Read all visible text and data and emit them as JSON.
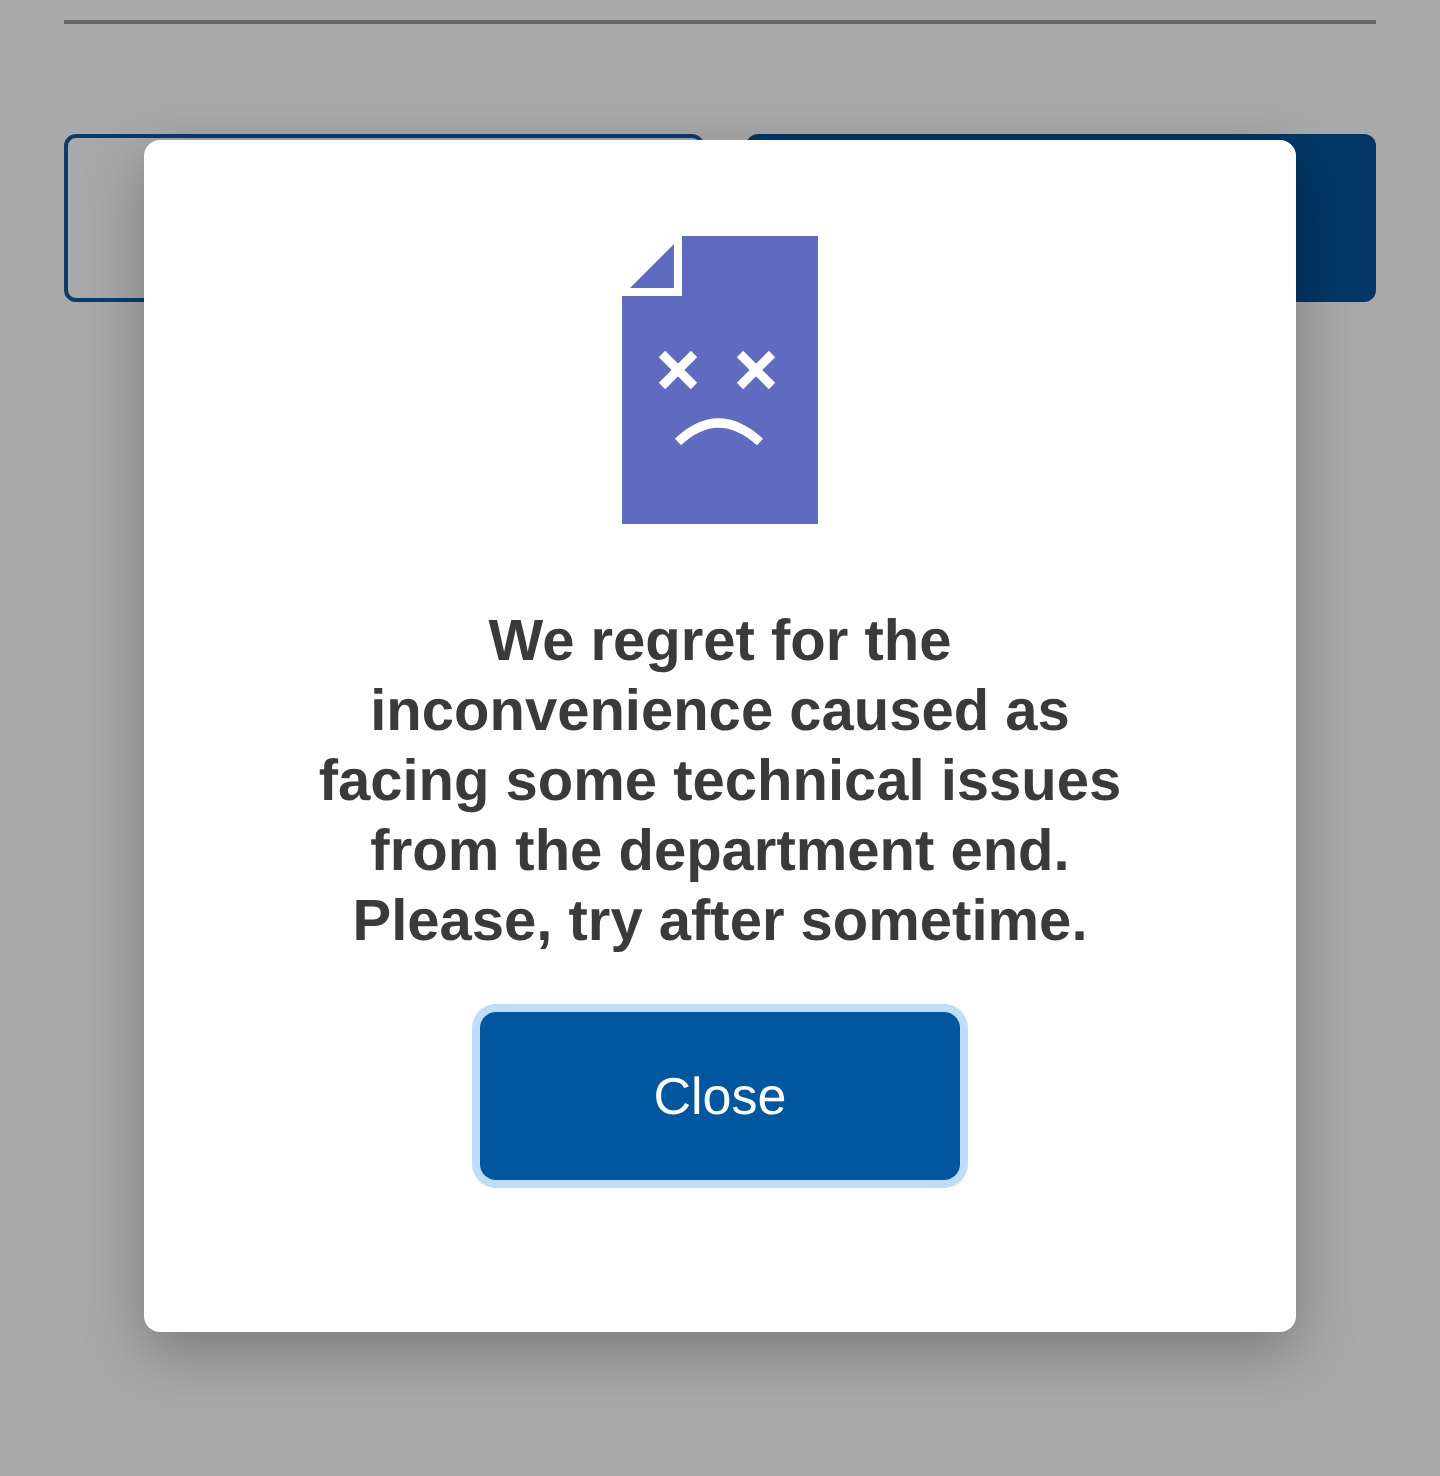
{
  "page": {
    "buttons": [
      {
        "kind": "outline"
      },
      {
        "kind": "filled"
      }
    ]
  },
  "dialog": {
    "message": "We regret for the inconvenience caused as facing some technical issues from the department end. Please, try after sometime.",
    "button": {
      "label": "Close",
      "focused": true
    }
  }
}
